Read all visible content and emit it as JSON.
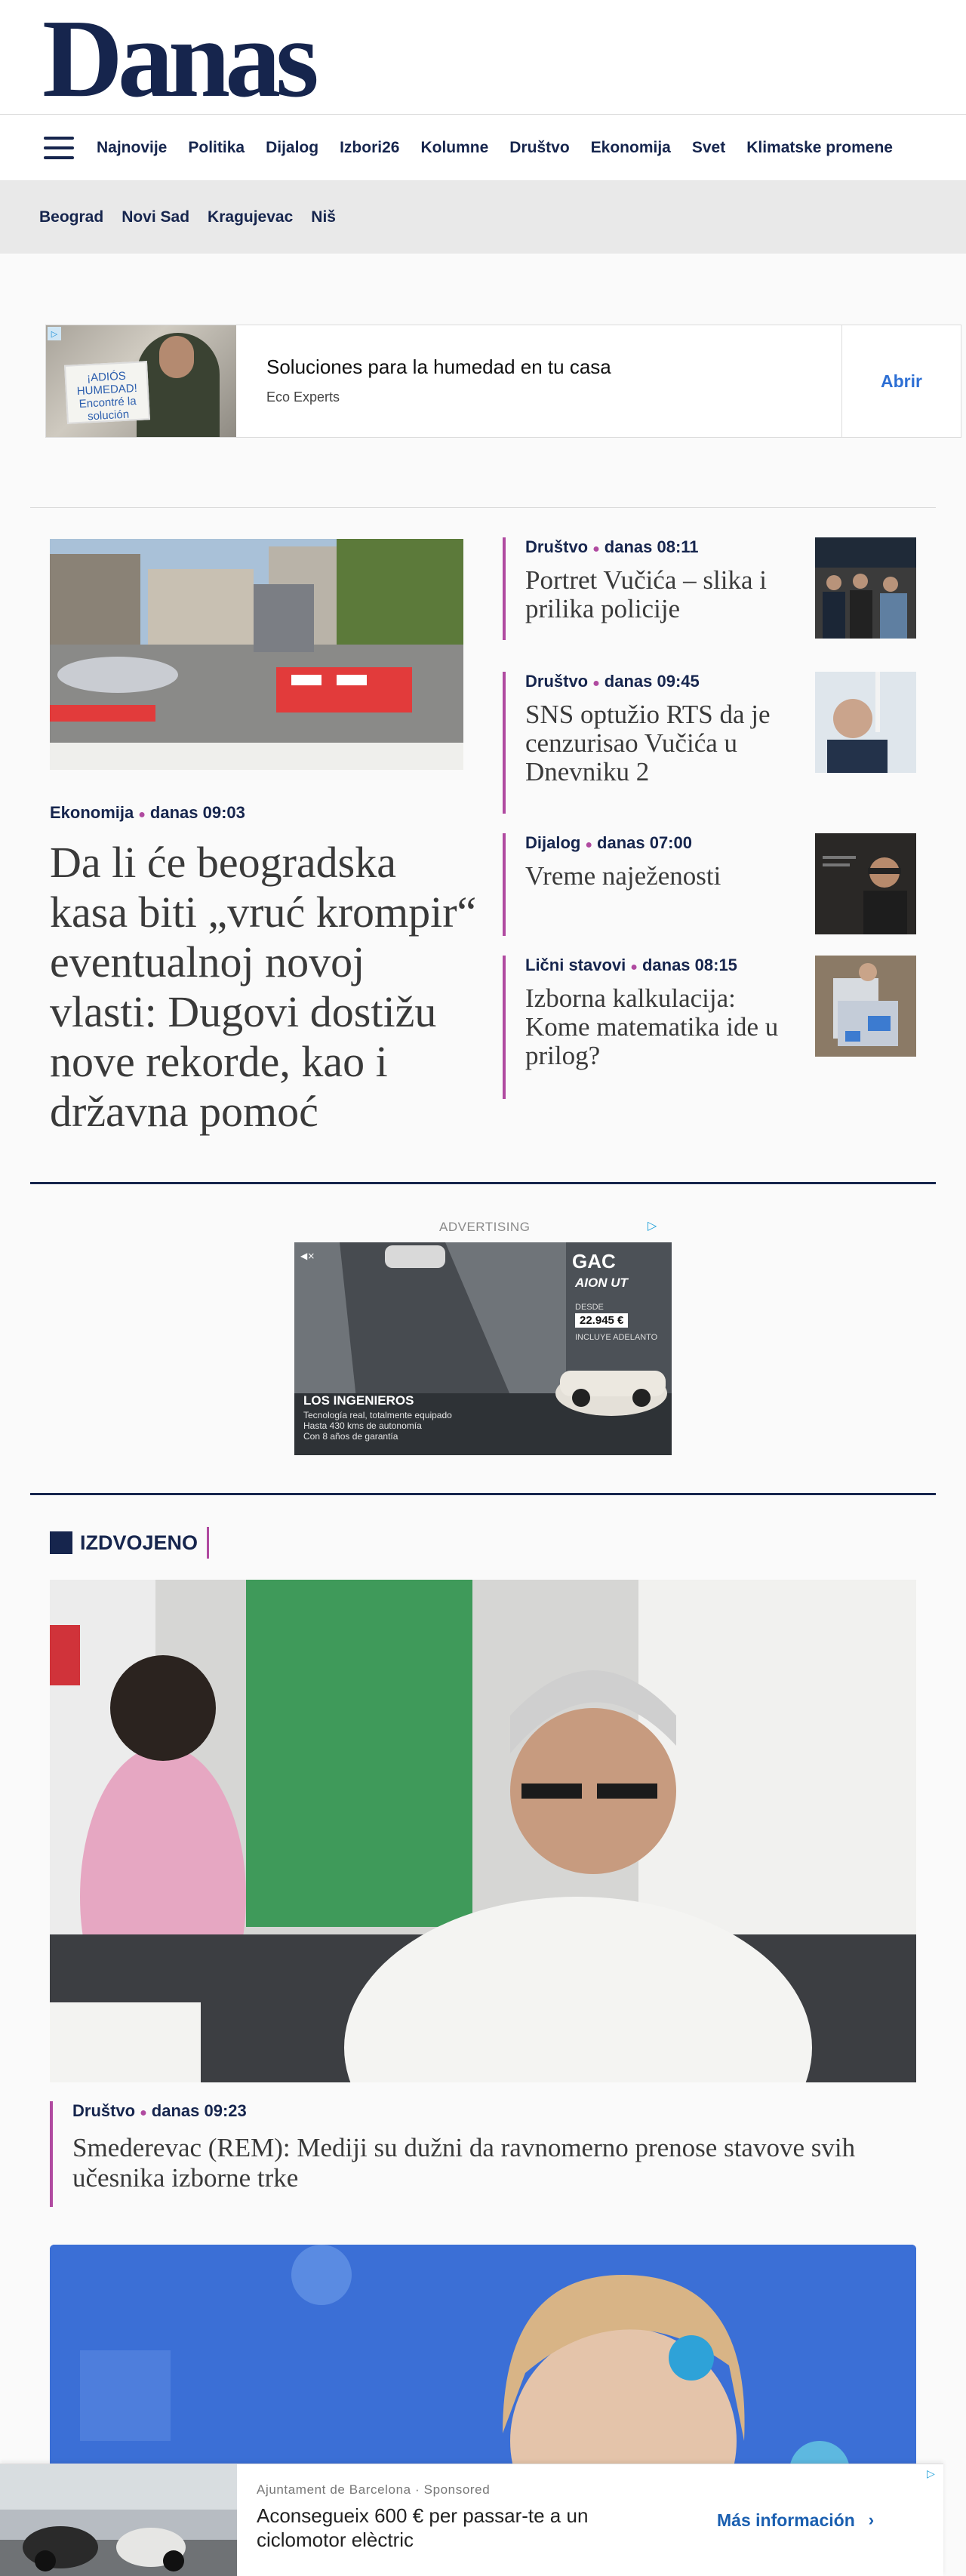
{
  "site": {
    "logo": "Danas"
  },
  "nav": {
    "menu_icon": "hamburger-menu-icon",
    "items": [
      "Najnovije",
      "Politika",
      "Dijalog",
      "Izbori26",
      "Kolumne",
      "Društvo",
      "Ekonomija",
      "Svet",
      "Klimatske promene"
    ]
  },
  "city_nav": {
    "items": [
      "Beograd",
      "Novi Sad",
      "Kragujevac",
      "Niš"
    ]
  },
  "ad_top": {
    "title": "Soluciones para la humedad en tu casa",
    "sponsor": "Eco Experts",
    "cta": "Abrir",
    "sign_text": "¡ADIÓS HUMEDAD! Encontré la solución"
  },
  "lead": {
    "category": "Ekonomija",
    "time": "danas 09:03",
    "title": "Da li će beogradska kasa biti „vruć krompir“ eventualnoj novoj vlasti: Dugovi dostižu nove rekorde, kao i državna pomoć"
  },
  "side_articles": [
    {
      "category": "Društvo",
      "time": "danas 08:11",
      "title": "Portret Vučića – slika i prilika policije"
    },
    {
      "category": "Društvo",
      "time": "danas 09:45",
      "title": "SNS optužio RTS da je cenzurisao Vučića u Dnevniku 2"
    },
    {
      "category": "Dijalog",
      "time": "danas 07:00",
      "title": "Vreme naježenosti"
    },
    {
      "category": "Lični stavovi",
      "time": "danas 08:15",
      "title": "Izborna kalkulacija: Kome matematika ide u prilog?"
    }
  ],
  "advertising": {
    "label": "ADVERTISING",
    "brand": "GAC",
    "model": "AION UT",
    "price_label": "DESDE",
    "price": "22.945 €",
    "price_note": "INCLUYE ADELANTO",
    "headline": "LOS INGENIEROS",
    "lines": [
      "Tecnología real, totalmente equipado",
      "Hasta 430 kms de autonomía",
      "Con 8 años de garantía"
    ]
  },
  "izdvojeno": {
    "label": "IZDVOJENO",
    "featured": {
      "category": "Društvo",
      "time": "danas 09:23",
      "title": "Smederevac (REM): Mediji su dužni da ravnomerno prenose stavove svih učesnika izborne trke"
    }
  },
  "sticky_ad": {
    "source": "Ajuntament de Barcelona",
    "sponsored": "Sponsored",
    "title": "Aconsegueix 600 € per passar-te a un ciclomotor elèctric",
    "cta": "Más información"
  },
  "colors": {
    "brand": "#16254d",
    "accent": "#b04aa0",
    "link_blue": "#2d6fd4"
  }
}
